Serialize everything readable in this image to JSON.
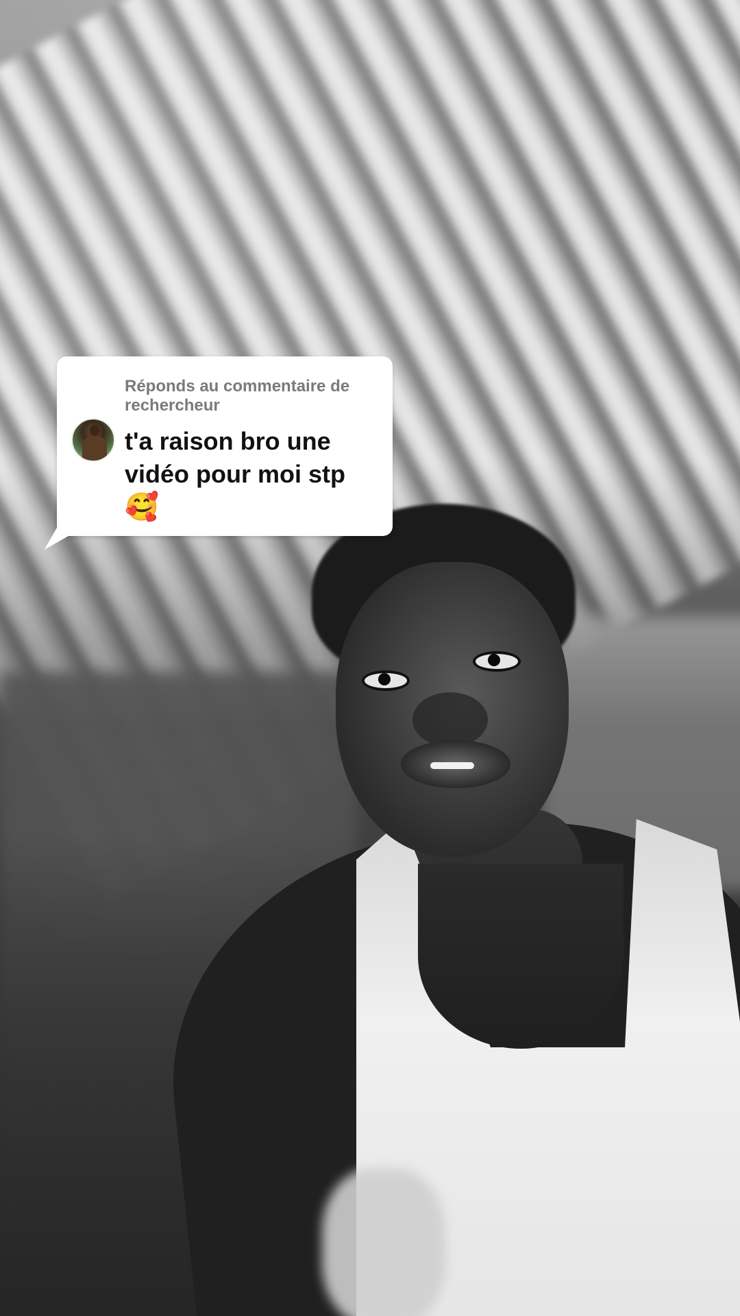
{
  "reply_sticker": {
    "header": "Réponds au commentaire de rechercheur",
    "comment_text": "t'a raison bro une vidéo pour moi stp",
    "emoji": "🥰",
    "avatar_icon": "user-avatar-icon"
  },
  "colors": {
    "bubble_bg": "#ffffff",
    "header_text": "#7a7a7a",
    "comment_text": "#111111"
  }
}
